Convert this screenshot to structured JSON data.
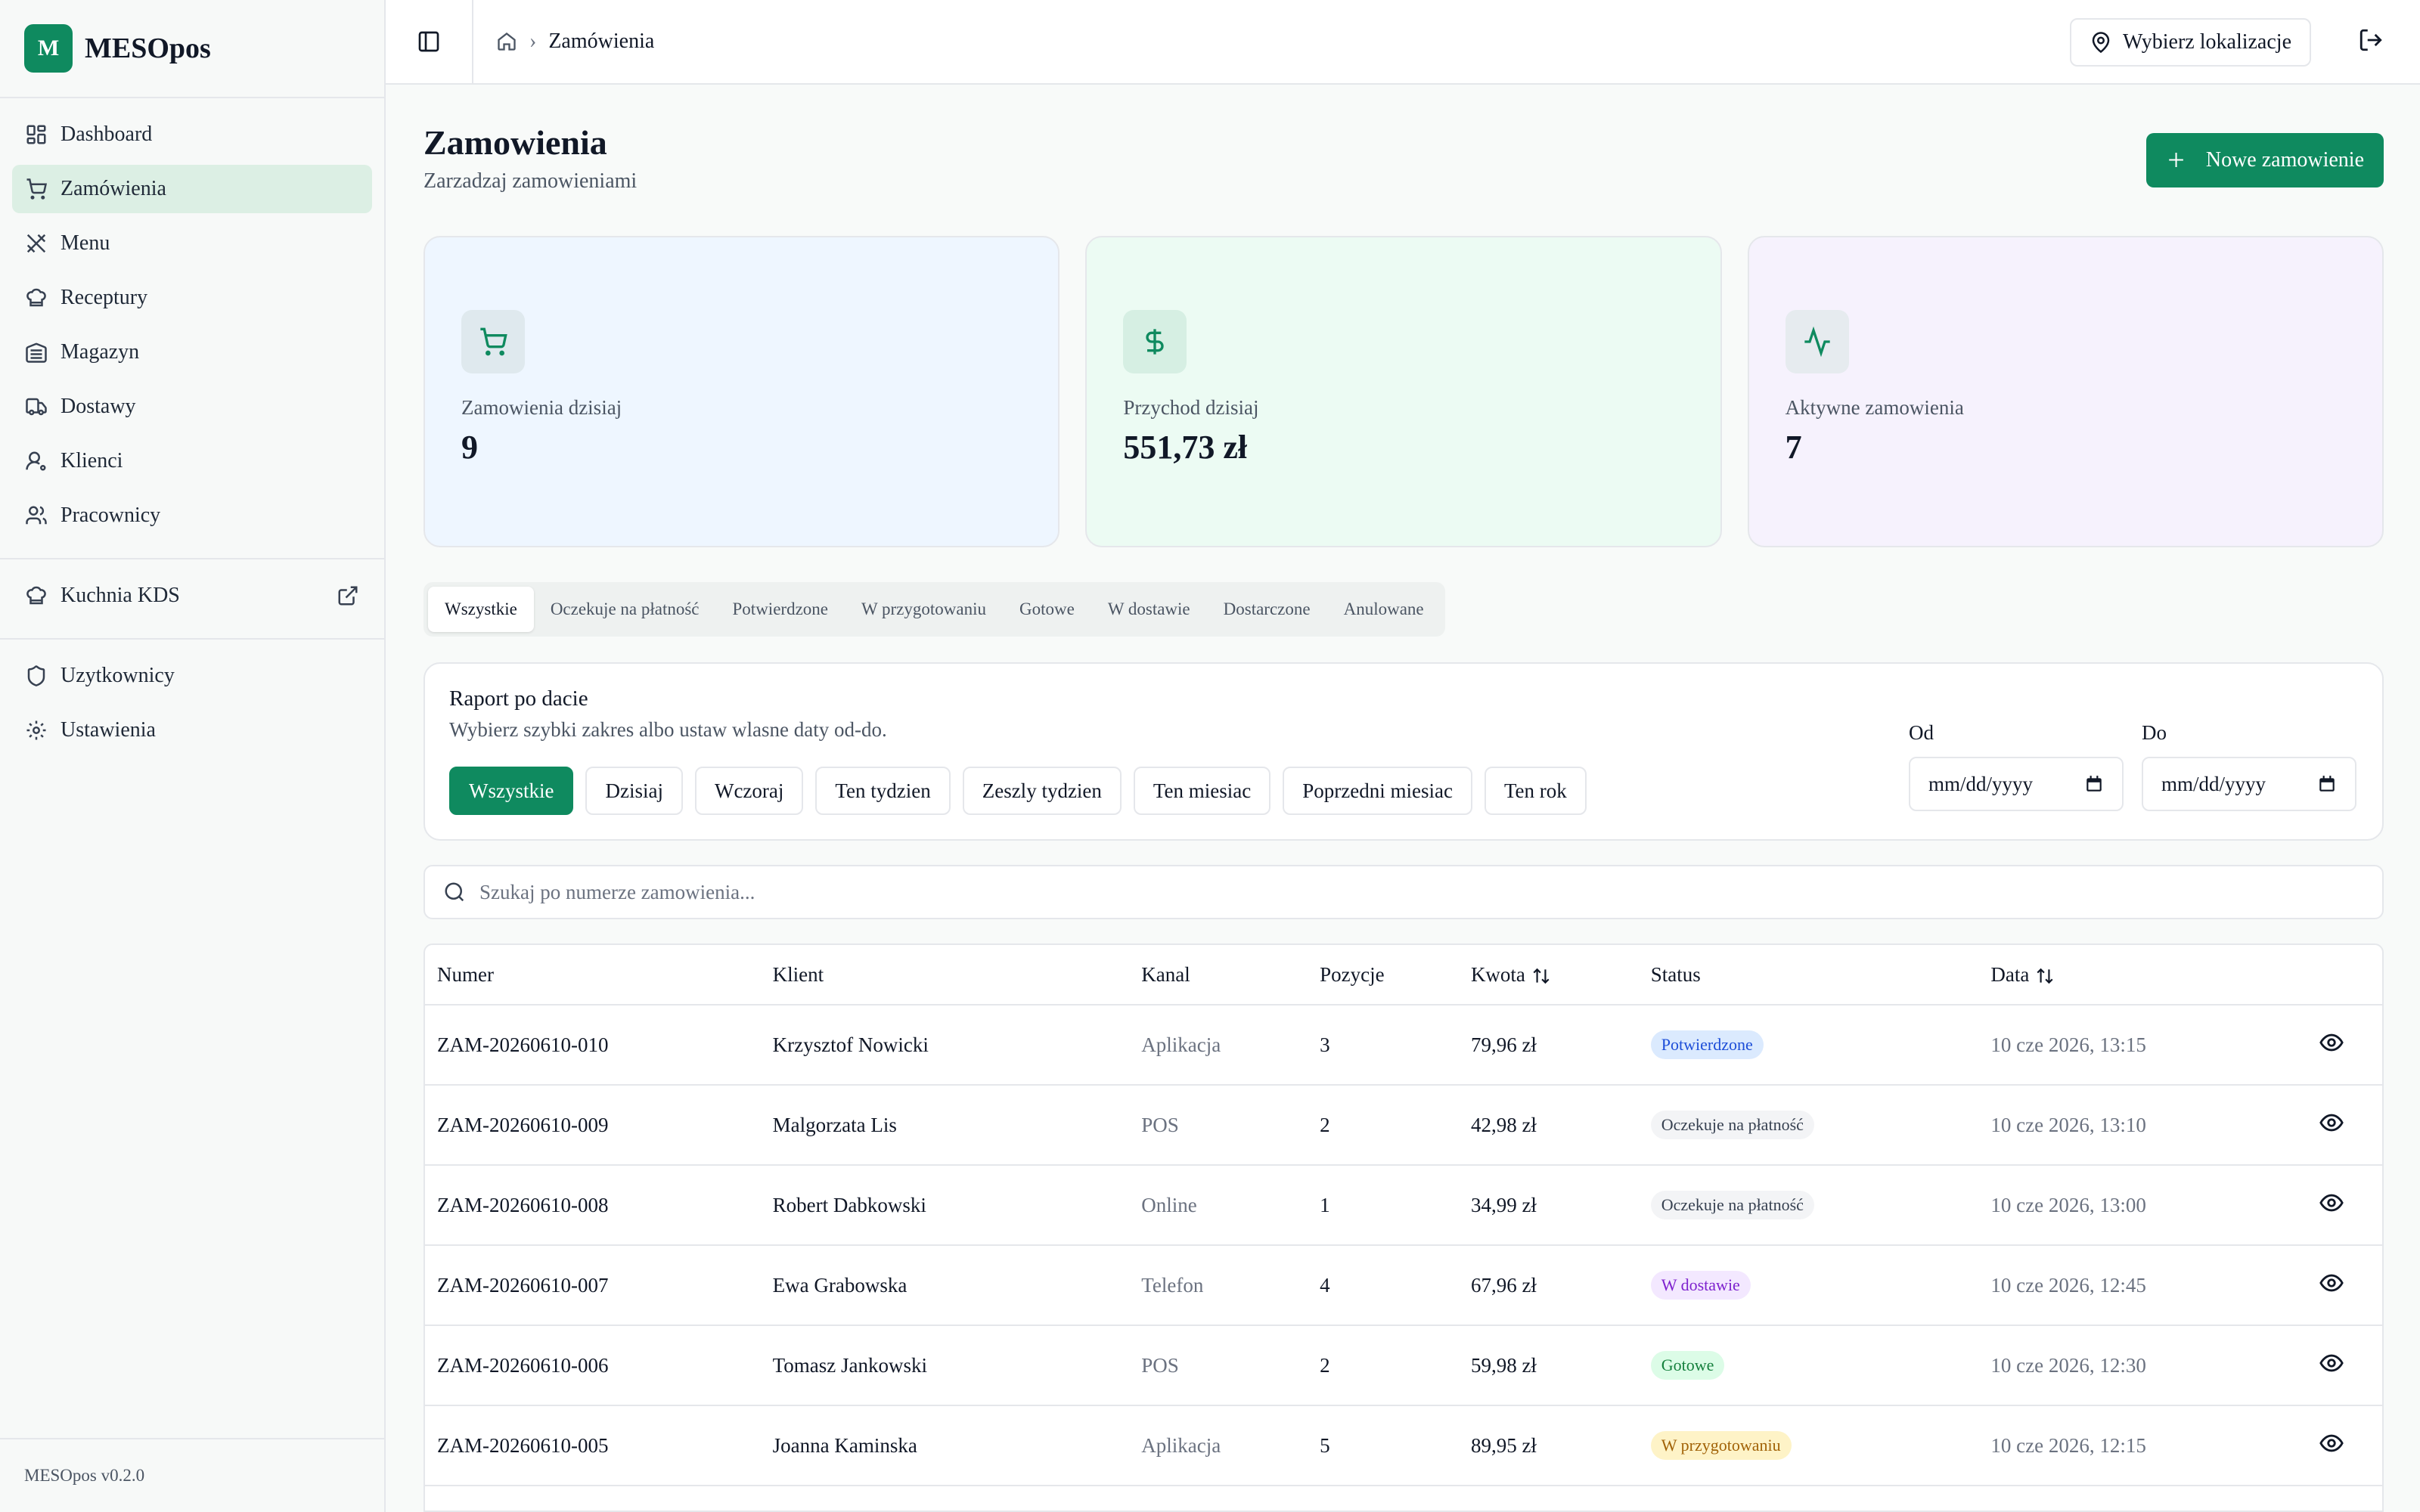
{
  "brand": {
    "logo_letter": "M",
    "name": "MESOpos"
  },
  "sidebar": {
    "items": [
      {
        "label": "Dashboard",
        "icon": "dashboard-icon"
      },
      {
        "label": "Zamówienia",
        "icon": "cart-icon",
        "active": true
      },
      {
        "label": "Menu",
        "icon": "utensils-icon"
      },
      {
        "label": "Receptury",
        "icon": "chef-hat-icon"
      },
      {
        "label": "Magazyn",
        "icon": "warehouse-icon"
      },
      {
        "label": "Dostawy",
        "icon": "truck-icon"
      },
      {
        "label": "Klienci",
        "icon": "user-icon"
      },
      {
        "label": "Pracownicy",
        "icon": "users-icon"
      }
    ],
    "kds": {
      "label": "Kuchnia KDS",
      "icon": "chef-hat-icon",
      "external_icon": "external-link-icon"
    },
    "admin": [
      {
        "label": "Uzytkownicy",
        "icon": "shield-icon"
      },
      {
        "label": "Ustawienia",
        "icon": "gear-icon"
      }
    ],
    "version": "MESOpos v0.2.0"
  },
  "topbar": {
    "breadcrumb_current": "Zamówienia",
    "location_button": "Wybierz lokalizacje"
  },
  "page": {
    "title": "Zamowienia",
    "subtitle": "Zarzadzaj zamowieniami",
    "new_button": "Nowe zamowienie"
  },
  "stats": [
    {
      "label": "Zamowienia dzisiaj",
      "value": "9",
      "icon": "cart-icon"
    },
    {
      "label": "Przychod dzisiaj",
      "value": "551,73 zł",
      "icon": "dollar-icon"
    },
    {
      "label": "Aktywne zamowienia",
      "value": "7",
      "icon": "activity-icon"
    }
  ],
  "tabs": [
    "Wszystkie",
    "Oczekuje na płatność",
    "Potwierdzone",
    "W przygotowaniu",
    "Gotowe",
    "W dostawie",
    "Dostarczone",
    "Anulowane"
  ],
  "report": {
    "title": "Raport po dacie",
    "subtitle": "Wybierz szybki zakres albo ustaw wlasne daty od-do.",
    "ranges": [
      "Wszystkie",
      "Dzisiaj",
      "Wczoraj",
      "Ten tydzien",
      "Zeszly tydzien",
      "Ten miesiac",
      "Poprzedni miesiac",
      "Ten rok"
    ],
    "from_label": "Od",
    "to_label": "Do",
    "date_placeholder": "mm/dd/yyyy"
  },
  "search": {
    "placeholder": "Szukaj po numerze zamowienia..."
  },
  "table": {
    "headers": [
      "Numer",
      "Klient",
      "Kanal",
      "Pozycje",
      "Kwota",
      "Status",
      "Data"
    ],
    "rows": [
      {
        "num": "ZAM-20260610-010",
        "client": "Krzysztof Nowicki",
        "channel": "Aplikacja",
        "items": "3",
        "amount": "79,96 zł",
        "status": "Potwierdzone",
        "date": "10 cze 2026, 13:15"
      },
      {
        "num": "ZAM-20260610-009",
        "client": "Malgorzata Lis",
        "channel": "POS",
        "items": "2",
        "amount": "42,98 zł",
        "status": "Oczekuje na płatność",
        "date": "10 cze 2026, 13:10"
      },
      {
        "num": "ZAM-20260610-008",
        "client": "Robert Dabkowski",
        "channel": "Online",
        "items": "1",
        "amount": "34,99 zł",
        "status": "Oczekuje na płatność",
        "date": "10 cze 2026, 13:00"
      },
      {
        "num": "ZAM-20260610-007",
        "client": "Ewa Grabowska",
        "channel": "Telefon",
        "items": "4",
        "amount": "67,96 zł",
        "status": "W dostawie",
        "date": "10 cze 2026, 12:45"
      },
      {
        "num": "ZAM-20260610-006",
        "client": "Tomasz Jankowski",
        "channel": "POS",
        "items": "2",
        "amount": "59,98 zł",
        "status": "Gotowe",
        "date": "10 cze 2026, 12:30"
      },
      {
        "num": "ZAM-20260610-005",
        "client": "Joanna Kaminska",
        "channel": "Aplikacja",
        "items": "5",
        "amount": "89,95 zł",
        "status": "W przygotowaniu",
        "date": "10 cze 2026, 12:15"
      }
    ]
  },
  "status_colors": {
    "Potwierdzone": {
      "bg": "#dbeafe",
      "fg": "#1d4ed8"
    },
    "Oczekuje na płatność": {
      "bg": "#f3f4f6",
      "fg": "#374151"
    },
    "W dostawie": {
      "bg": "#f3e8ff",
      "fg": "#7e22ce"
    },
    "Gotowe": {
      "bg": "#dcfce7",
      "fg": "#15803d"
    },
    "W przygotowaniu": {
      "bg": "#fef3c7",
      "fg": "#a16207"
    }
  },
  "colors": {
    "accent": "#0f8a5f"
  }
}
